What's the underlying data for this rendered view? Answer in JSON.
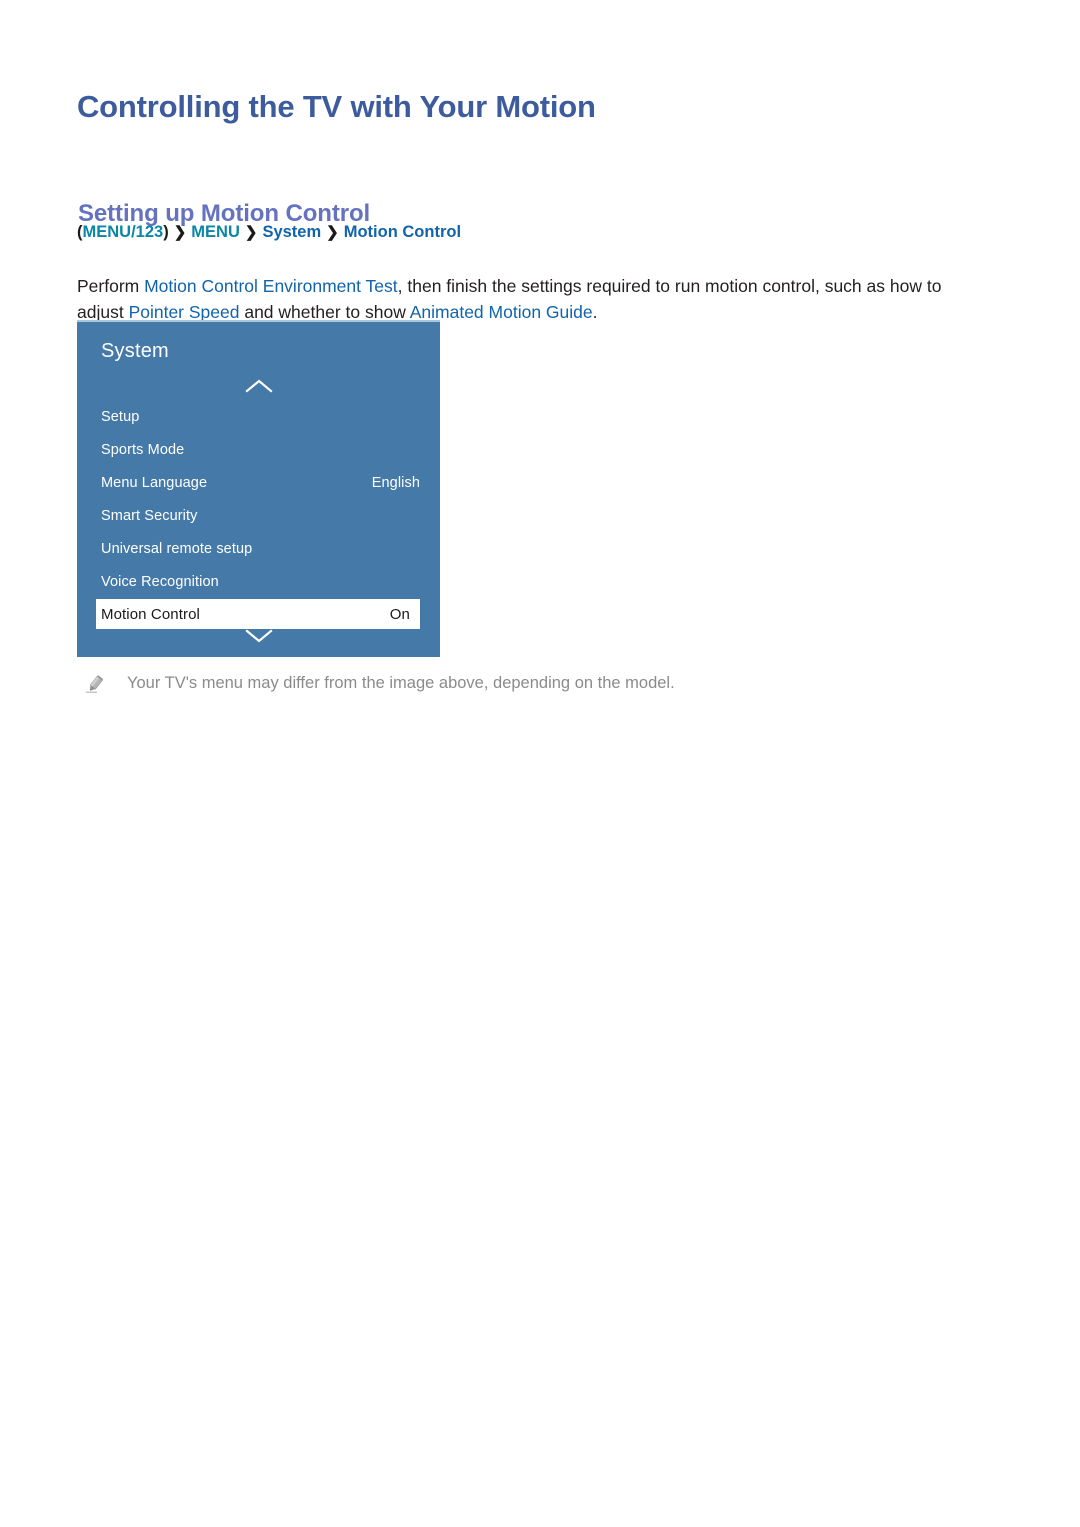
{
  "document": {
    "title": "Controlling the TV with Your Motion",
    "section_heading": "Setting up Motion Control"
  },
  "breadcrumb": {
    "open_paren": "(",
    "menu123": "MENU/123",
    "close_paren": ")",
    "separator": "❯",
    "menu": "MENU",
    "system": "System",
    "motion_control": "Motion Control",
    "teal_color": "#0a87a6",
    "blue_color": "#1164ab"
  },
  "paragraph": {
    "part1": "Perform ",
    "hl1": "Motion Control Environment Test",
    "part2": ", then finish the settings required to run motion control, such as how to adjust ",
    "hl2": "Pointer Speed",
    "part3": " and whether to show ",
    "hl3": "Animated Motion Guide",
    "part4": "."
  },
  "tv_menu": {
    "panel_title": "System",
    "panel_color": "#4479a8",
    "scroll_up_icon": "chevron-up-icon",
    "scroll_down_icon": "chevron-down-icon",
    "items": [
      {
        "label": "Setup",
        "value": "",
        "selected": false
      },
      {
        "label": "Sports Mode",
        "value": "",
        "selected": false
      },
      {
        "label": "Menu Language",
        "value": "English",
        "selected": false
      },
      {
        "label": "Smart Security",
        "value": "",
        "selected": false
      },
      {
        "label": "Universal remote setup",
        "value": "",
        "selected": false
      },
      {
        "label": "Voice Recognition",
        "value": "",
        "selected": false
      },
      {
        "label": "Motion Control",
        "value": "On",
        "selected": true
      }
    ]
  },
  "note": {
    "icon": "pencil-note-icon",
    "text": "Your TV's menu may differ from the image above, depending on the model."
  }
}
